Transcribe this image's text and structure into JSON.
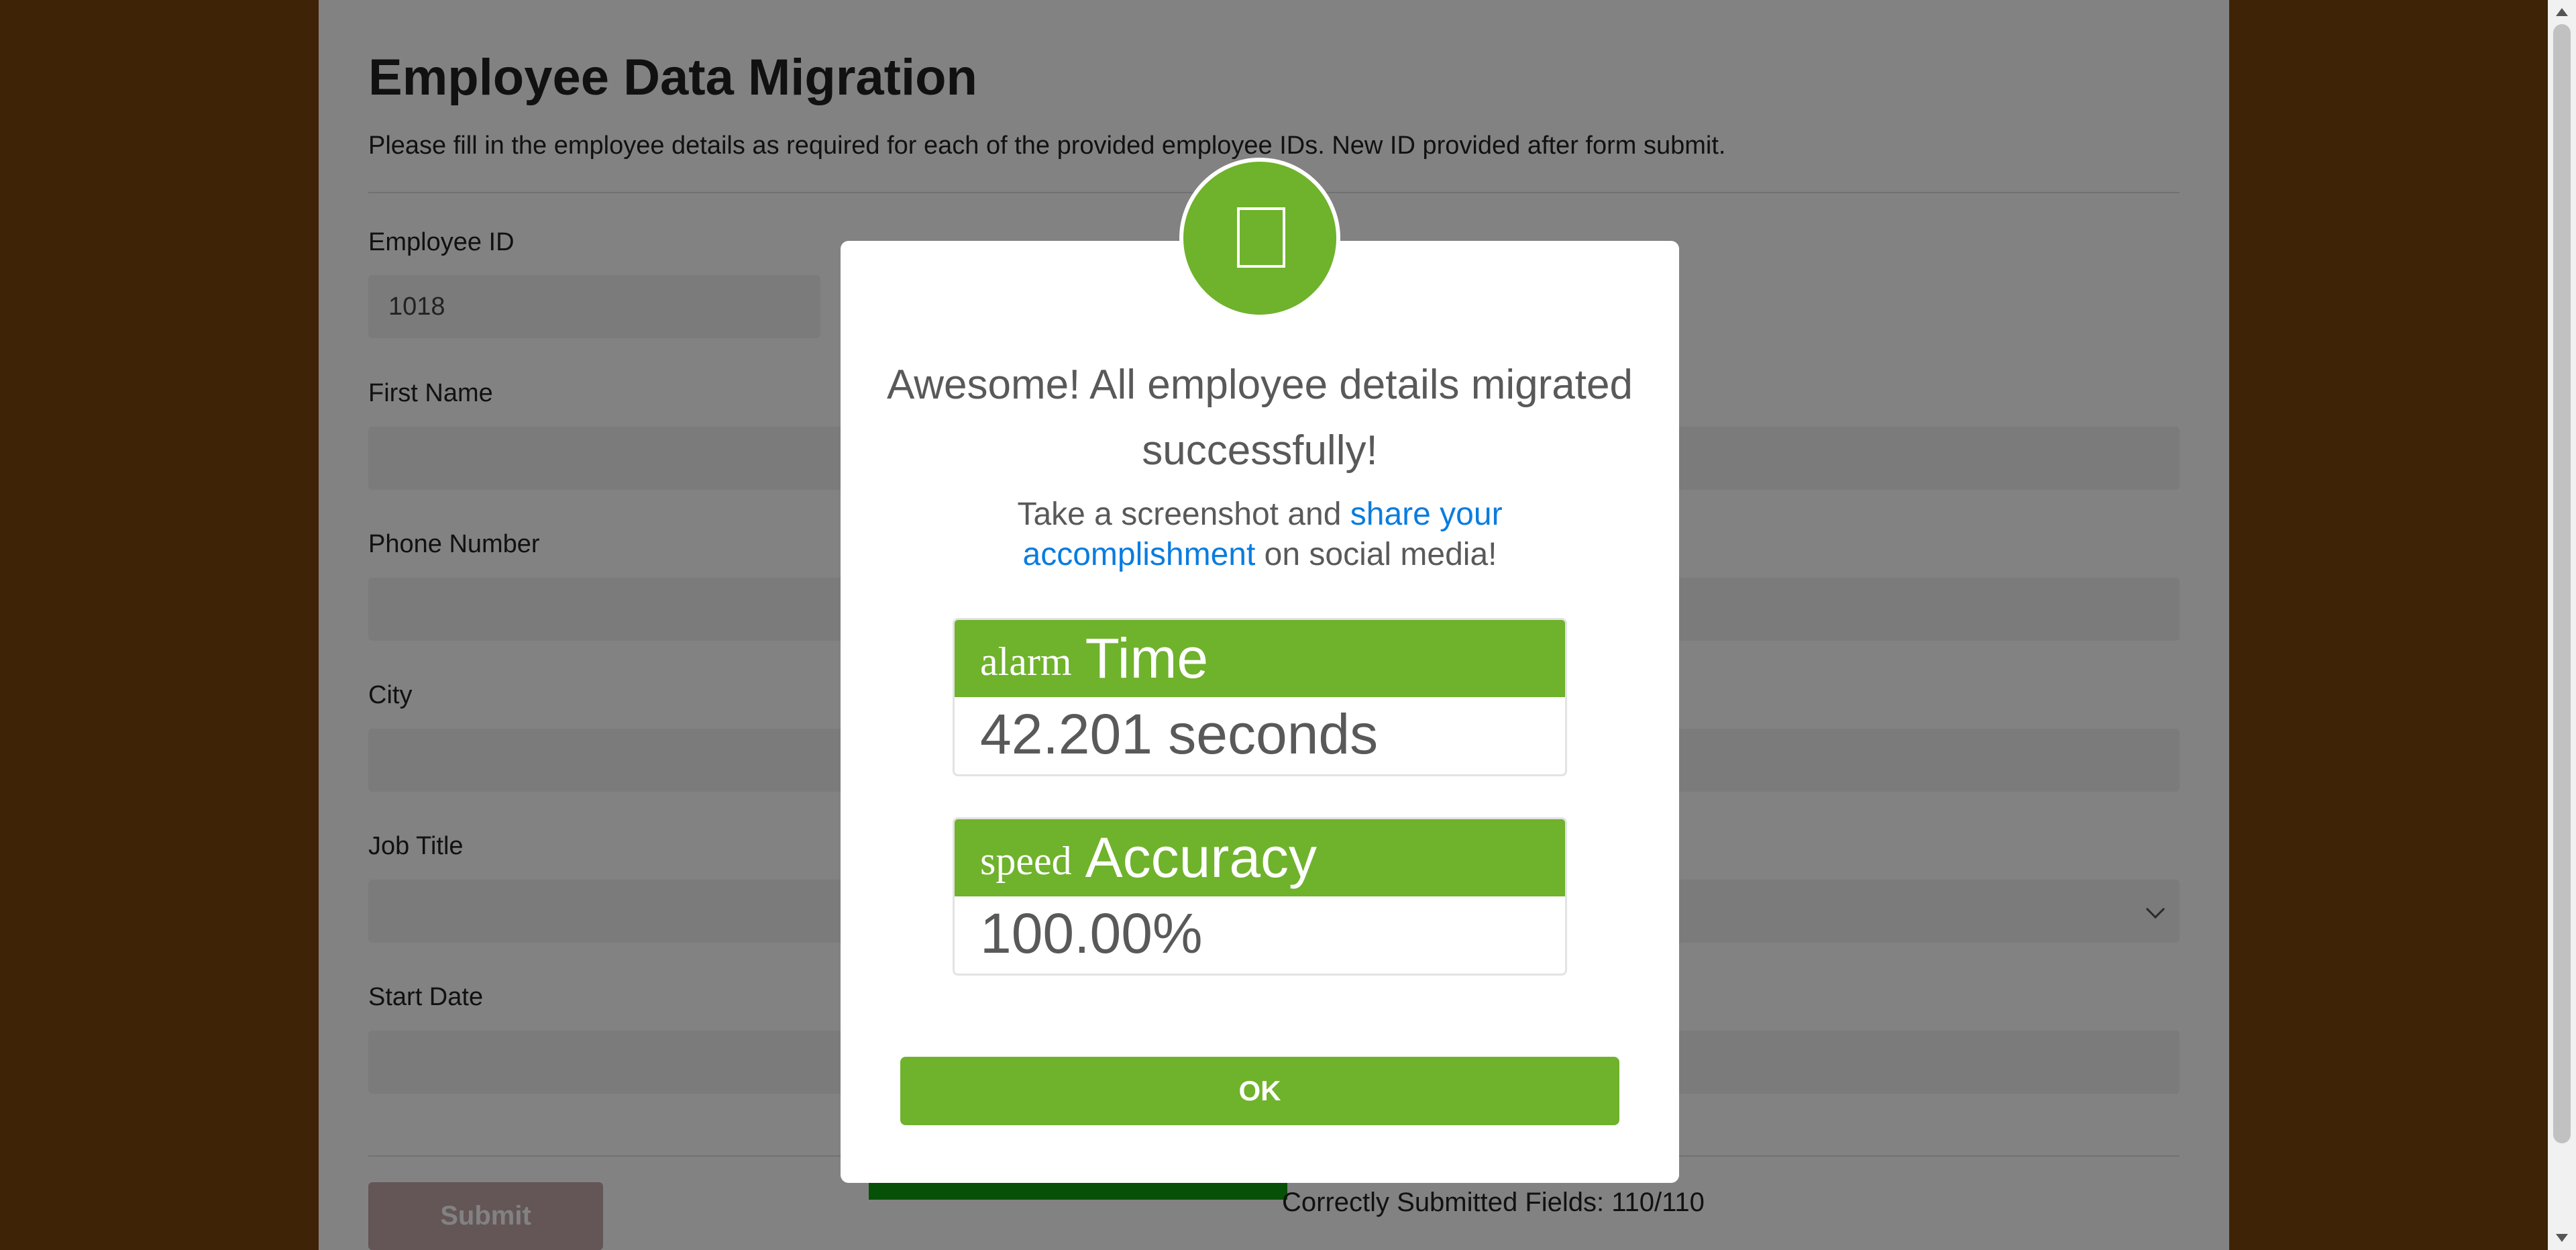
{
  "form": {
    "title": "Employee Data Migration",
    "description": "Please fill in the employee details as required for each of the provided employee IDs. New ID provided after form submit.",
    "fields": [
      {
        "label": "Employee ID",
        "value": "1018"
      },
      {
        "label": "First Name",
        "value": ""
      },
      {
        "label": "Phone Number",
        "value": ""
      },
      {
        "label": "City",
        "value": ""
      },
      {
        "label": "Job Title",
        "value": ""
      },
      {
        "label": "Start Date",
        "value": ""
      }
    ],
    "submit_label": "Submit",
    "score_text": "Correctly Submitted Fields: 110/110"
  },
  "modal": {
    "heading": "Awesome! All employee details migrated successfully!",
    "share_prefix": "Take a screenshot and ",
    "share_link": "share your accomplishment",
    "share_suffix": " on social media!",
    "stats": [
      {
        "icon_word": "alarm",
        "title": "Time",
        "value": "42.201 seconds"
      },
      {
        "icon_word": "speed",
        "title": "Accuracy",
        "value": "100.00%"
      }
    ],
    "ok_label": "OK"
  },
  "colors": {
    "accent": "#6fb22c",
    "background": "#7a450c",
    "link": "#0a7ce0"
  }
}
